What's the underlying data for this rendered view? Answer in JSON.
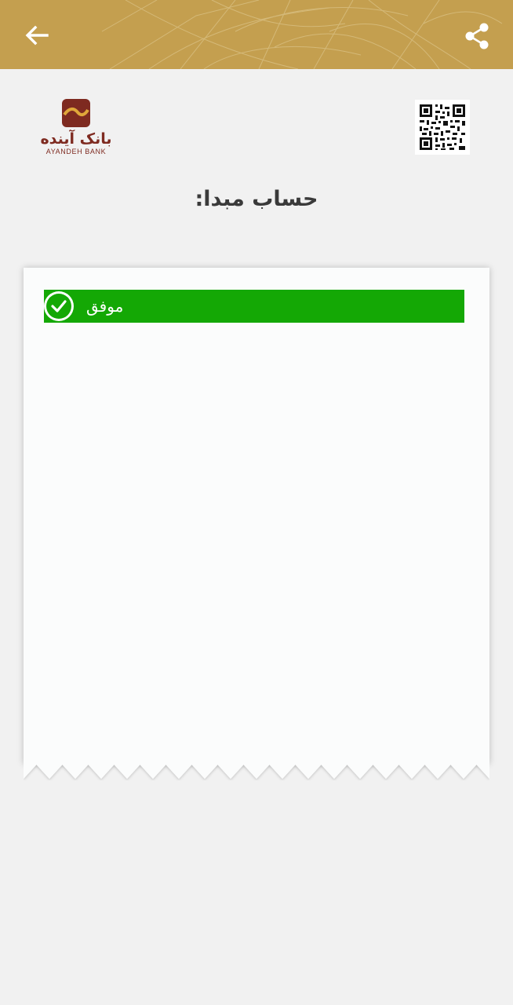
{
  "header": {
    "back_icon": "arrow-left-icon",
    "share_icon": "share-icon",
    "background_color": "#c49f4f"
  },
  "logo": {
    "name_fa": "بانک آینده",
    "name_en": "AYANDEH BANK",
    "brand_color": "#7e2a20",
    "accent_color": "#e0a73a"
  },
  "qr": {
    "icon": "qr-code-icon"
  },
  "receipt": {
    "title": "حساب مبدا:",
    "status": {
      "label": "موفق",
      "color": "#14a805",
      "icon": "check-circle-icon"
    }
  }
}
